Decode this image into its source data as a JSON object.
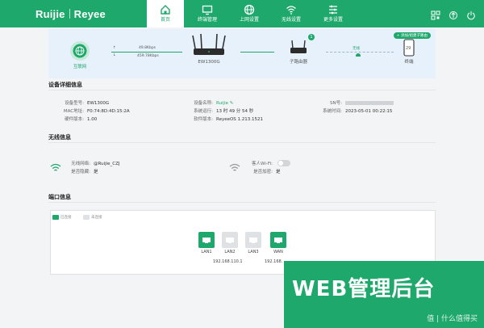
{
  "header": {
    "brand_left": "Ruijie",
    "brand_right": "Reyee",
    "nav": [
      {
        "label": "首页",
        "icon": "home-icon",
        "active": true
      },
      {
        "label": "终端管理",
        "icon": "monitor-icon",
        "active": false
      },
      {
        "label": "上网设置",
        "icon": "globe-icon",
        "active": false
      },
      {
        "label": "无线设置",
        "icon": "wifi-icon",
        "active": false
      },
      {
        "label": "更多设置",
        "icon": "sliders-icon",
        "active": false
      }
    ],
    "right_icons": [
      "qrcode-icon",
      "upgrade-icon",
      "logout-icon"
    ]
  },
  "topology": {
    "internet_label": "互联网",
    "upload_speed": "49.8Kbps",
    "download_speed": "459.78Kbps",
    "router_label": "EW1300G",
    "sub_router_label": "子路由器",
    "sub_router_count": "1",
    "wireless_label": "无线",
    "terminal_label": "终端",
    "terminal_count": "29",
    "add_button": "+ 添加/组建子路由"
  },
  "device_info": {
    "title": "设备详细信息",
    "model_key": "设备型号:",
    "model_val": "EW1300G",
    "mac_key": "MAC地址:",
    "mac_val": "F0:74:8D:4D:15:2A",
    "hw_key": "硬件版本:",
    "hw_val": "1.00",
    "name_key": "设备名称:",
    "name_val": "Ruijie",
    "uptime_key": "系统运行:",
    "uptime_val": "13 时 49 分 54 秒",
    "sw_key": "软件版本:",
    "sw_val": "ReyeeOS 1.213.1521",
    "sn_key": "SN号:",
    "time_key": "系统时间:",
    "time_val": "2023-05-01 00:22:15"
  },
  "wireless": {
    "title": "无线信息",
    "ssid_key": "无线网络:",
    "ssid_val": "@Ruijie_CZJ",
    "hidden_key": "是否隐藏:",
    "hidden_val": "是",
    "guest_key": "客人Wi-Fi:",
    "encrypt_key": "是否加密:",
    "encrypt_val": "是",
    "guest_enabled": false
  },
  "ports": {
    "title": "端口信息",
    "legend_connected": "已连接",
    "legend_disconnected": "未连接",
    "items": [
      {
        "name": "LAN1",
        "connected": true
      },
      {
        "name": "LAN2",
        "connected": false
      },
      {
        "name": "LAN3",
        "connected": false
      },
      {
        "name": "WAN",
        "connected": true
      }
    ],
    "lan_ip": "192.168.110.1",
    "wan_ip": "192.168."
  },
  "overlay": {
    "text": "WEB管理后台",
    "watermark": "值 | 什么值得买"
  },
  "colors": {
    "brand_green": "#1fa86b",
    "topo_bg": "#e6f1fb"
  }
}
